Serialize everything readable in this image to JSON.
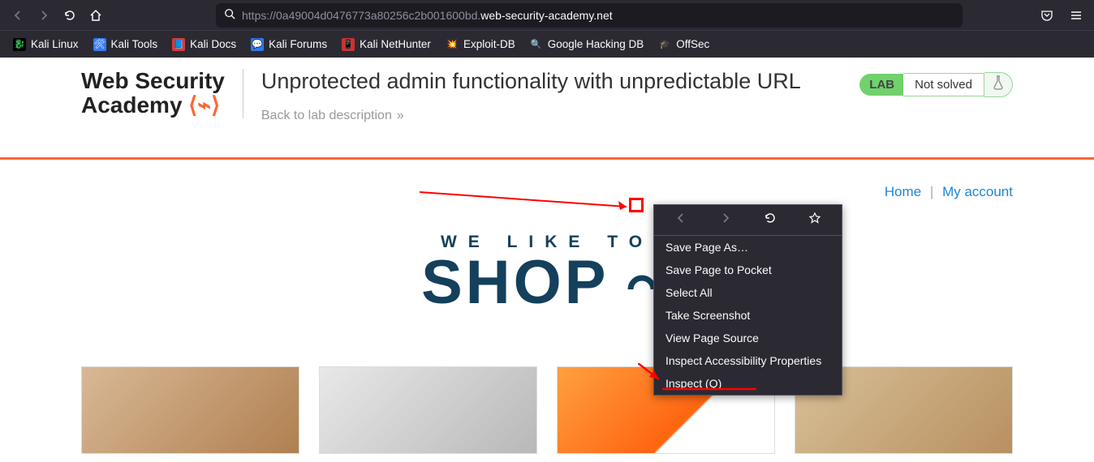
{
  "browser": {
    "url_dim_prefix": "https://0a49004d0476773a80256c2b001600bd.",
    "url_bright": "web-security-academy.net",
    "bookmarks": [
      {
        "label": "Kali Linux",
        "icon": "🐉",
        "bg": "#000"
      },
      {
        "label": "Kali Tools",
        "icon": "🛠",
        "bg": "#367bf0"
      },
      {
        "label": "Kali Docs",
        "icon": "📘",
        "bg": "#e63434"
      },
      {
        "label": "Kali Forums",
        "icon": "💬",
        "bg": "#2b7de9"
      },
      {
        "label": "Kali NetHunter",
        "icon": "📱",
        "bg": "#d03030"
      },
      {
        "label": "Exploit-DB",
        "icon": "💥",
        "bg": "transparent"
      },
      {
        "label": "Google Hacking DB",
        "icon": "🔍",
        "bg": "transparent"
      },
      {
        "label": "OffSec",
        "icon": "🎓",
        "bg": "transparent"
      }
    ]
  },
  "header": {
    "logo_line1": "Web Security",
    "logo_line2": "Academy",
    "title": "Unprotected admin functionality with unpredictable URL",
    "back": "Back to lab description",
    "badge": "LAB",
    "status": "Not solved"
  },
  "nav": {
    "home": "Home",
    "account": "My account"
  },
  "hero": {
    "tagline": "WE LIKE TO",
    "main": "SHOP"
  },
  "context_menu": {
    "items": [
      "Save Page As…",
      "Save Page to Pocket",
      "Select All",
      "Take Screenshot",
      "View Page Source",
      "Inspect Accessibility Properties",
      "Inspect (Q)"
    ]
  }
}
